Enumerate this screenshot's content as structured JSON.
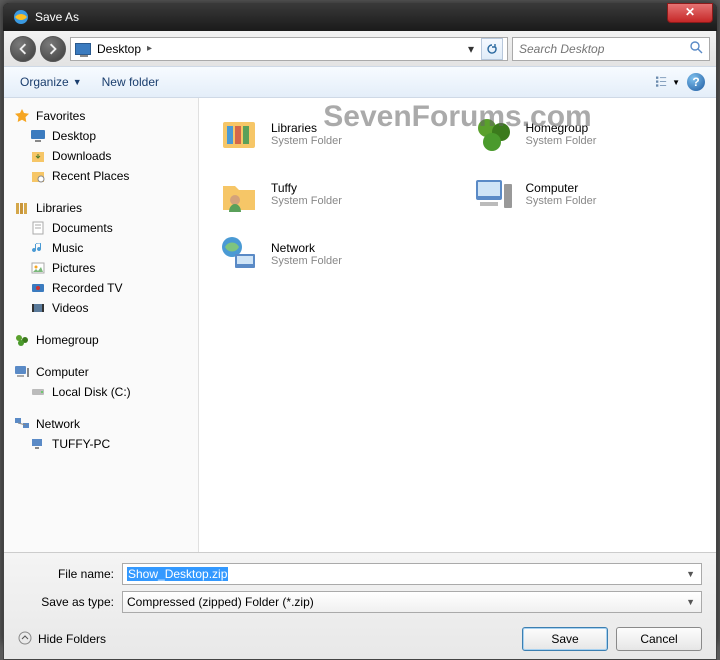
{
  "window": {
    "title": "Save As"
  },
  "nav": {
    "location": "Desktop",
    "search_placeholder": "Search Desktop"
  },
  "toolbar": {
    "organize": "Organize",
    "new_folder": "New folder"
  },
  "sidebar": {
    "favorites": {
      "label": "Favorites",
      "items": [
        "Desktop",
        "Downloads",
        "Recent Places"
      ]
    },
    "libraries": {
      "label": "Libraries",
      "items": [
        "Documents",
        "Music",
        "Pictures",
        "Recorded TV",
        "Videos"
      ]
    },
    "homegroup": {
      "label": "Homegroup"
    },
    "computer": {
      "label": "Computer",
      "items": [
        "Local Disk (C:)"
      ]
    },
    "network": {
      "label": "Network",
      "items": [
        "TUFFY-PC"
      ]
    }
  },
  "content": {
    "watermark": "SevenForums.com",
    "system_folder": "System Folder",
    "items": [
      {
        "name": "Libraries",
        "icon": "libraries"
      },
      {
        "name": "Homegroup",
        "icon": "homegroup"
      },
      {
        "name": "Tuffy",
        "icon": "user"
      },
      {
        "name": "Computer",
        "icon": "computer"
      },
      {
        "name": "Network",
        "icon": "network"
      }
    ]
  },
  "footer": {
    "filename_label": "File name:",
    "filename_value": "Show_Desktop.zip",
    "type_label": "Save as type:",
    "type_value": "Compressed (zipped) Folder (*.zip)",
    "hide_folders": "Hide Folders",
    "save": "Save",
    "cancel": "Cancel"
  }
}
